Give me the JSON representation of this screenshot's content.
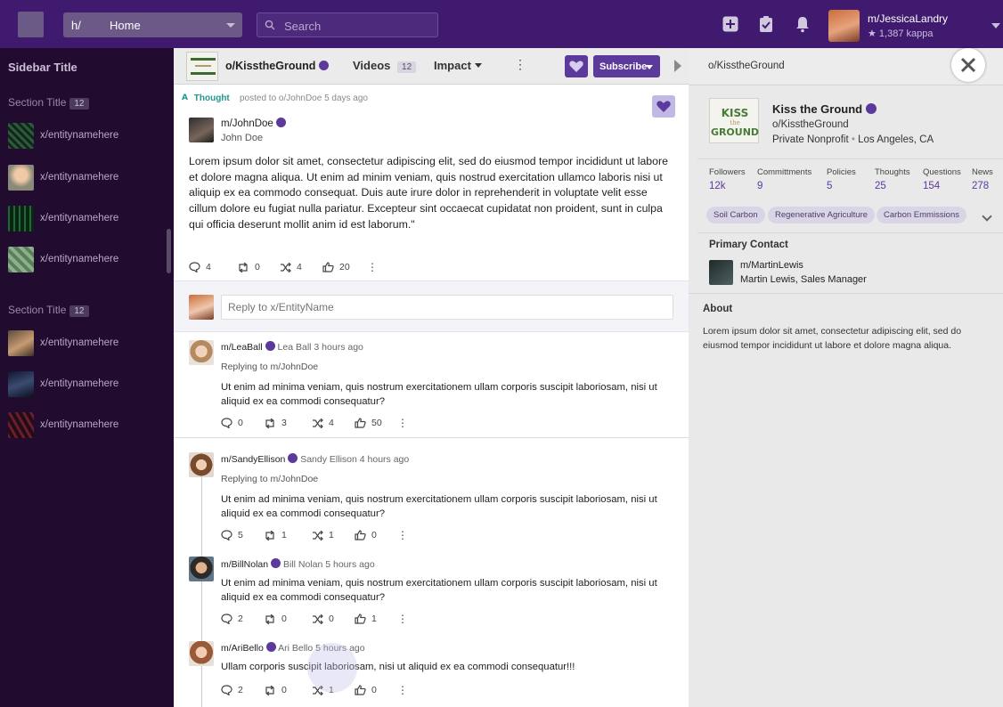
{
  "topbar": {
    "space_prefix": "h/",
    "space_value": "Home",
    "search_placeholder": "Search",
    "user_name": "m/JessicaLandry",
    "user_karma": "1,387 kappa"
  },
  "sidebar": {
    "title": "Sidebar Title",
    "sections": [
      {
        "title": "Section Title",
        "count": "12",
        "items": [
          "x/entitynamehere",
          "x/entitynamehere",
          "x/entitynamehere",
          "x/entitynamehere"
        ]
      },
      {
        "title": "Section Title",
        "count": "12",
        "items": [
          "x/entitynamehere",
          "x/entitynamehere",
          "x/entitynamehere"
        ]
      }
    ]
  },
  "entity_header": {
    "name": "o/KisstheGround",
    "videos_label": "Videos",
    "videos_count": "12",
    "impact_label": "Impact",
    "subscribe_label": "Subscribe"
  },
  "post": {
    "type_label": "Thought",
    "posted_meta": "posted to o/JohnDoe 5 days ago",
    "author_handle": "m/JohnDoe",
    "author_name": "John Doe",
    "body": "Lorem ipsum dolor sit amet, consectetur adipiscing elit, sed do eiusmod tempor incididunt ut labore et dolore magna aliqua. Ut enim ad minim veniam, quis nostrud exercitation ullamco laboris nisi ut aliquip ex ea commodo consequat. Duis aute irure dolor in reprehenderit in voluptate velit esse cillum dolore eu fugiat nulla pariatur. Excepteur sint occaecat cupidatat non proident, sunt in culpa qui officia deserunt mollit anim id est laborum.\"",
    "comments": "4",
    "reposts": "0",
    "shares": "4",
    "likes": "20"
  },
  "reply": {
    "placeholder": "Reply to x/EntityName"
  },
  "comments": [
    {
      "handle": "m/LeaBall",
      "name": "Lea Ball",
      "time": "3 hours ago",
      "replying": "Replying to m/JohnDoe",
      "body": "Ut enim ad minima veniam, quis nostrum exercitationem ullam corporis suscipit laboriosam, nisi ut aliquid ex ea commodi consequatur?",
      "comments": "0",
      "reposts": "3",
      "shares": "4",
      "likes": "50"
    },
    {
      "handle": "m/SandyEllison",
      "name": "Sandy Ellison",
      "time": "4 hours ago",
      "replying": "Replying to m/JohnDoe",
      "body": "Ut enim ad minima veniam, quis nostrum exercitationem ullam corporis suscipit laboriosam, nisi ut aliquid ex ea commodi consequatur?",
      "comments": "5",
      "reposts": "1",
      "shares": "1",
      "likes": "0"
    },
    {
      "handle": "m/BillNolan",
      "name": "Bill Nolan",
      "time": "5 hours ago",
      "body": "Ut enim ad minima veniam, quis nostrum exercitationem ullam corporis suscipit laboriosam, nisi ut aliquid ex ea commodi consequatur?",
      "comments": "2",
      "reposts": "0",
      "shares": "0",
      "likes": "1"
    },
    {
      "handle": "m/AriBello",
      "name": "Ari Bello",
      "time": "5 hours ago",
      "body": "Ullam corporis suscipit laboriosam, nisi ut aliquid ex ea commodi consequatur!!!",
      "comments": "2",
      "reposts": "0",
      "shares": "1",
      "likes": "0"
    }
  ],
  "profile": {
    "header_name": "o/KisstheGround",
    "logo_text": "KISS the GROUND",
    "name": "Kiss the Ground",
    "handle": "o/KisstheGround",
    "type": "Private Nonprofit",
    "location": "Los Angeles, CA",
    "stats": [
      {
        "label": "Followers",
        "value": "12k"
      },
      {
        "label": "Committments",
        "value": "9"
      },
      {
        "label": "Policies",
        "value": "5"
      },
      {
        "label": "Thoughts",
        "value": "25"
      },
      {
        "label": "Questions",
        "value": "154"
      },
      {
        "label": "News",
        "value": "278"
      }
    ],
    "tags": [
      "Soil Carbon",
      "Regenerative Agriculture",
      "Carbon Emmissions"
    ],
    "primary_contact_title": "Primary Contact",
    "contact_handle": "m/MartinLewis",
    "contact_role": "Martin Lewis, Sales Manager",
    "about_title": "About",
    "about_body": "Lorem ipsum dolor sit amet, consectetur adipiscing elit, sed do eiusmod tempor incididunt ut labore et dolore magna aliqua."
  },
  "colors": {
    "brand_purple": "#3f1a6e",
    "accent": "#5b3a9b",
    "sidebar_bg": "#210b2f",
    "thought_teal": "#23958e"
  }
}
